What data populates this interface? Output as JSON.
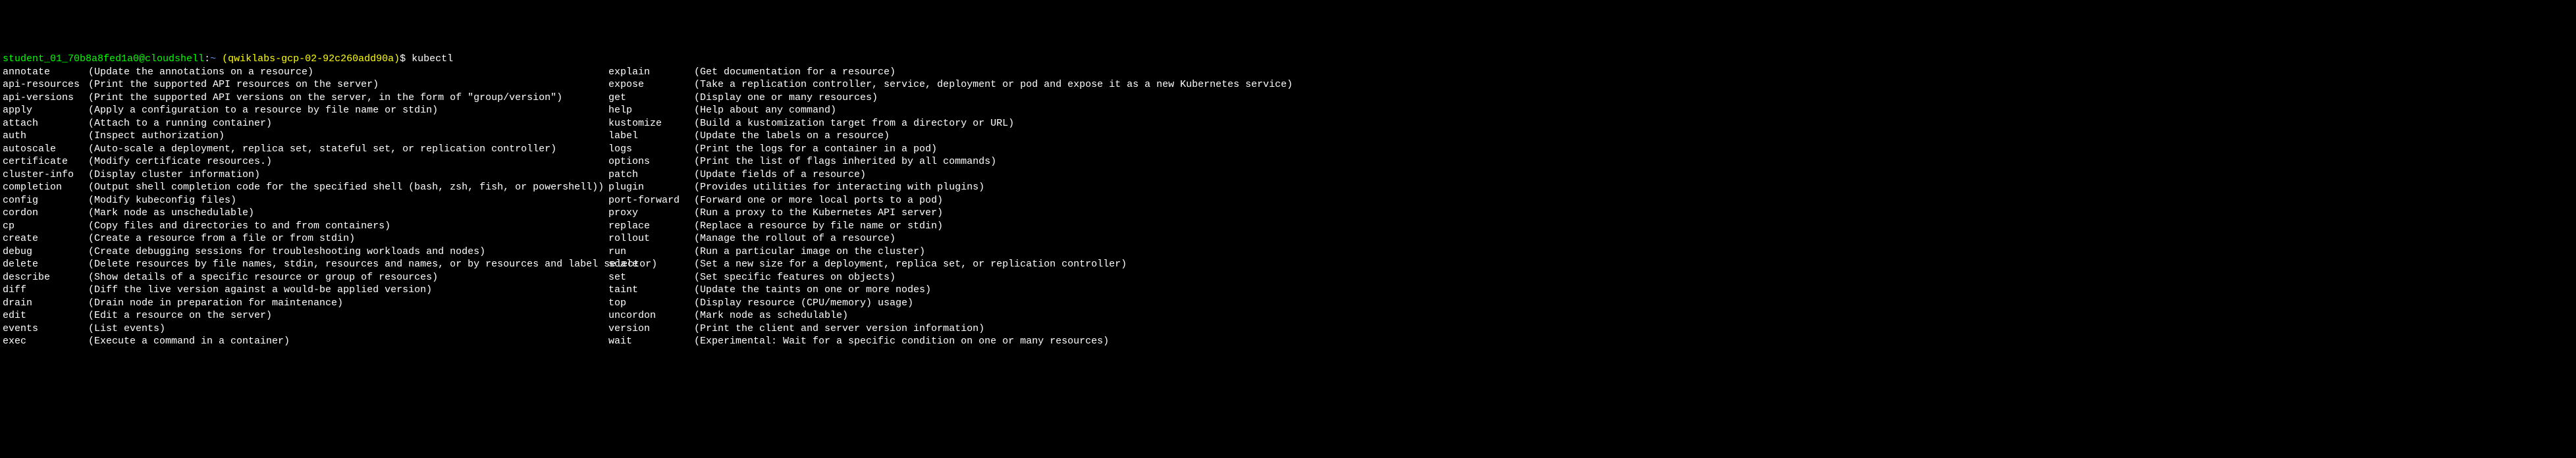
{
  "prompt": {
    "user_host": "student_01_70b8a8fed1a0@cloudshell",
    "colon": ":",
    "tilde": "~",
    "space_open": " ",
    "project": "(qwiklabs-gcp-02-92c260add90a)",
    "dollar": "$",
    "command": " kubectl"
  },
  "left_commands": [
    {
      "name": "annotate",
      "desc": "(Update the annotations on a resource)"
    },
    {
      "name": "api-resources",
      "desc": "(Print the supported API resources on the server)"
    },
    {
      "name": "api-versions",
      "desc": "(Print the supported API versions on the server, in the form of \"group/version\")"
    },
    {
      "name": "apply",
      "desc": "(Apply a configuration to a resource by file name or stdin)"
    },
    {
      "name": "attach",
      "desc": "(Attach to a running container)"
    },
    {
      "name": "auth",
      "desc": "(Inspect authorization)"
    },
    {
      "name": "autoscale",
      "desc": "(Auto-scale a deployment, replica set, stateful set, or replication controller)"
    },
    {
      "name": "certificate",
      "desc": "(Modify certificate resources.)"
    },
    {
      "name": "cluster-info",
      "desc": "(Display cluster information)"
    },
    {
      "name": "completion",
      "desc": "(Output shell completion code for the specified shell (bash, zsh, fish, or powershell))"
    },
    {
      "name": "config",
      "desc": "(Modify kubeconfig files)"
    },
    {
      "name": "cordon",
      "desc": "(Mark node as unschedulable)"
    },
    {
      "name": "cp",
      "desc": "(Copy files and directories to and from containers)"
    },
    {
      "name": "create",
      "desc": "(Create a resource from a file or from stdin)"
    },
    {
      "name": "debug",
      "desc": "(Create debugging sessions for troubleshooting workloads and nodes)"
    },
    {
      "name": "delete",
      "desc": "(Delete resources by file names, stdin, resources and names, or by resources and label selector)"
    },
    {
      "name": "describe",
      "desc": "(Show details of a specific resource or group of resources)"
    },
    {
      "name": "diff",
      "desc": "(Diff the live version against a would-be applied version)"
    },
    {
      "name": "drain",
      "desc": "(Drain node in preparation for maintenance)"
    },
    {
      "name": "edit",
      "desc": "(Edit a resource on the server)"
    },
    {
      "name": "events",
      "desc": "(List events)"
    },
    {
      "name": "exec",
      "desc": "(Execute a command in a container)"
    }
  ],
  "right_commands": [
    {
      "name": "explain",
      "desc": "(Get documentation for a resource)"
    },
    {
      "name": "expose",
      "desc": "(Take a replication controller, service, deployment or pod and expose it as a new Kubernetes service)"
    },
    {
      "name": "get",
      "desc": "(Display one or many resources)"
    },
    {
      "name": "help",
      "desc": "(Help about any command)"
    },
    {
      "name": "kustomize",
      "desc": "(Build a kustomization target from a directory or URL)"
    },
    {
      "name": "label",
      "desc": "(Update the labels on a resource)"
    },
    {
      "name": "logs",
      "desc": "(Print the logs for a container in a pod)"
    },
    {
      "name": "options",
      "desc": "(Print the list of flags inherited by all commands)"
    },
    {
      "name": "patch",
      "desc": "(Update fields of a resource)"
    },
    {
      "name": "plugin",
      "desc": "(Provides utilities for interacting with plugins)"
    },
    {
      "name": "port-forward",
      "desc": "(Forward one or more local ports to a pod)"
    },
    {
      "name": "proxy",
      "desc": "(Run a proxy to the Kubernetes API server)"
    },
    {
      "name": "replace",
      "desc": "(Replace a resource by file name or stdin)"
    },
    {
      "name": "rollout",
      "desc": "(Manage the rollout of a resource)"
    },
    {
      "name": "run",
      "desc": "(Run a particular image on the cluster)"
    },
    {
      "name": "scale",
      "desc": "(Set a new size for a deployment, replica set, or replication controller)"
    },
    {
      "name": "set",
      "desc": "(Set specific features on objects)"
    },
    {
      "name": "taint",
      "desc": "(Update the taints on one or more nodes)"
    },
    {
      "name": "top",
      "desc": "(Display resource (CPU/memory) usage)"
    },
    {
      "name": "uncordon",
      "desc": "(Mark node as schedulable)"
    },
    {
      "name": "version",
      "desc": "(Print the client and server version information)"
    },
    {
      "name": "wait",
      "desc": "(Experimental: Wait for a specific condition on one or many resources)"
    }
  ]
}
